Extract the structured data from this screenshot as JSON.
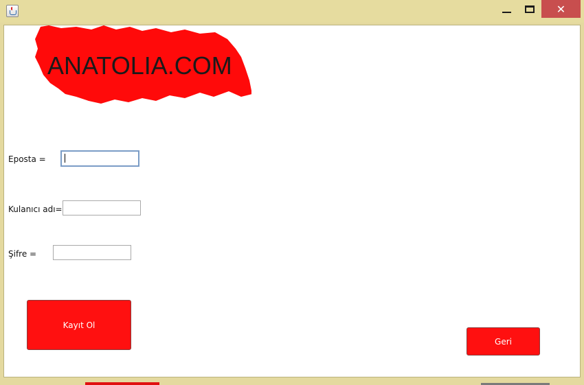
{
  "window": {
    "icon": "java-cup-icon",
    "controls": {
      "minimize_icon": "minimize-icon",
      "maximize_icon": "maximize-icon",
      "close_glyph": "✕"
    }
  },
  "logo": {
    "text": "ANATOLIA.COM",
    "shape_color": "#ff0a0a"
  },
  "form": {
    "email_label": "Eposta =",
    "email_value": "",
    "username_label": "Kulanıcı adı=",
    "username_value": "",
    "password_label": "Şifre =",
    "password_value": ""
  },
  "buttons": {
    "register_label": "Kayıt Ol",
    "back_label": "Geri"
  },
  "colors": {
    "titlebar": "#e6dc9f",
    "close": "#c84e4e",
    "accent_red": "#ff1010"
  }
}
